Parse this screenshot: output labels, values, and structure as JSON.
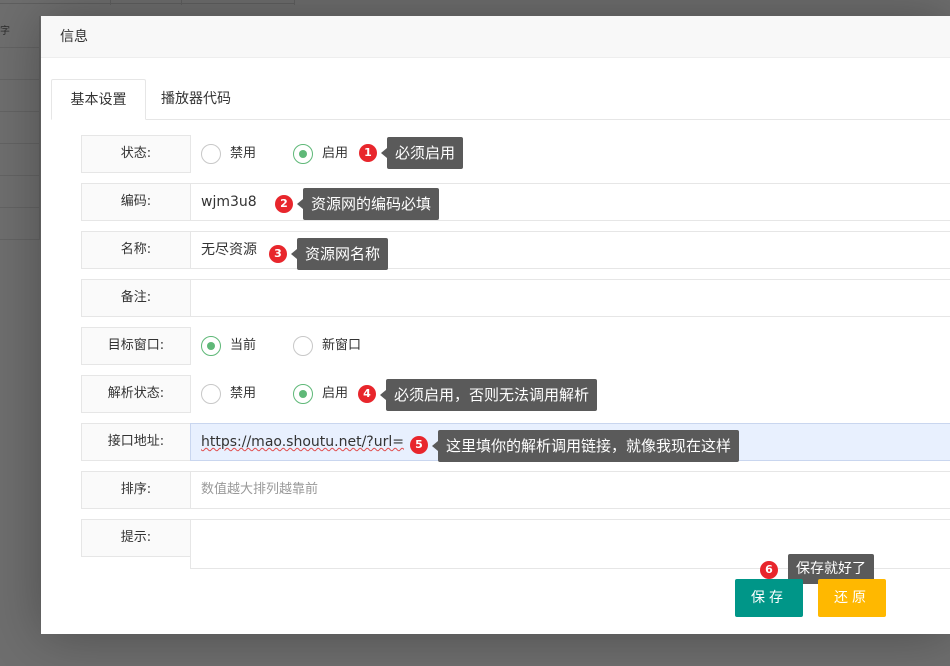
{
  "dialog": {
    "title": "信息"
  },
  "tabs": [
    {
      "label": "基本设置"
    },
    {
      "label": "播放器代码"
    }
  ],
  "bg": {
    "header_fragment": "字"
  },
  "form": {
    "status": {
      "label": "状态:",
      "options": [
        "禁用",
        "启用"
      ],
      "selected": "启用"
    },
    "code": {
      "label": "编码:",
      "value": "wjm3u8"
    },
    "name": {
      "label": "名称:",
      "value": "无尽资源"
    },
    "remark": {
      "label": "备注:",
      "value": ""
    },
    "target": {
      "label": "目标窗口:",
      "options": [
        "当前",
        "新窗口"
      ],
      "selected": "当前"
    },
    "parse_status": {
      "label": "解析状态:",
      "options": [
        "禁用",
        "启用"
      ],
      "selected": "启用"
    },
    "api_url": {
      "label": "接口地址:",
      "value": "https://mao.shoutu.net/?url="
    },
    "sort": {
      "label": "排序:",
      "placeholder": "数值越大排列越靠前"
    },
    "hint": {
      "label": "提示:",
      "value": ""
    }
  },
  "annotations": [
    {
      "num": "1",
      "text": "必须启用"
    },
    {
      "num": "2",
      "text": "资源网的编码必填"
    },
    {
      "num": "3",
      "text": "资源网名称"
    },
    {
      "num": "4",
      "text": "必须启用，否则无法调用解析"
    },
    {
      "num": "5",
      "text": "这里填你的解析调用链接，就像我现在这样"
    },
    {
      "num": "6",
      "text": "保存就好了"
    }
  ],
  "buttons": {
    "save": "保存",
    "reset": "还原"
  },
  "colors": {
    "radio_on": "#5fb878",
    "save": "#009688",
    "reset": "#ffb800",
    "badge": "#e8262c",
    "tooltip": "#5a5a5a"
  }
}
